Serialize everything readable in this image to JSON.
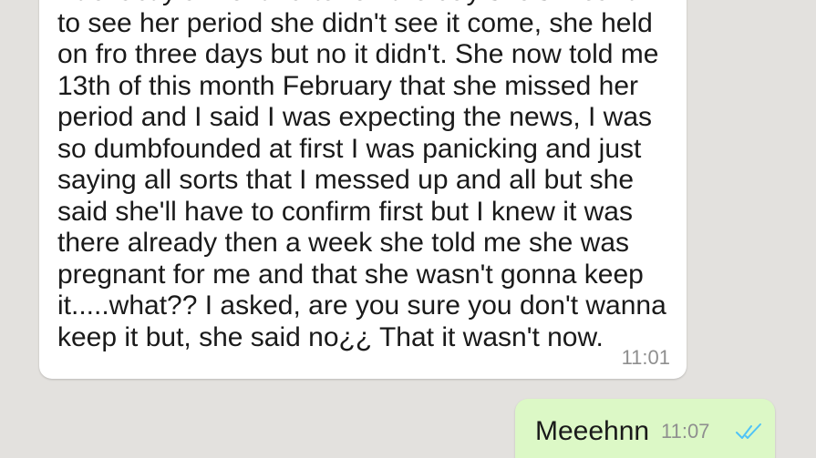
{
  "messages": {
    "incoming": {
      "lines": [
        "At exactly a month after on the day she's meant",
        "to see her period she didn't see it come, she held",
        "on fro three days but no it didn't. She now told me",
        "13th of this month February that she missed her",
        "period and I said I was expecting the news, I was",
        "so dumbfounded at first I was panicking and just",
        "saying all sorts that I messed up and all but she",
        "said she'll have to confirm first but I knew it was",
        "there already then a week she told me she was",
        "pregnant for me and that she wasn't gonna keep",
        "it.....what?? I asked, are you sure you don't wanna",
        "keep it but, she said no¿¿ That it wasn't now."
      ],
      "time": "11:01"
    },
    "outgoing": {
      "text": "Meeehnn",
      "time": "11:07",
      "status_icon": "double-check-read-icon"
    }
  },
  "colors": {
    "background": "#e3e1de",
    "incoming_bubble": "#ffffff",
    "outgoing_bubble": "#dcf8c6",
    "read_ticks": "#4fc3f7",
    "timestamp": "#8f8f8f"
  }
}
